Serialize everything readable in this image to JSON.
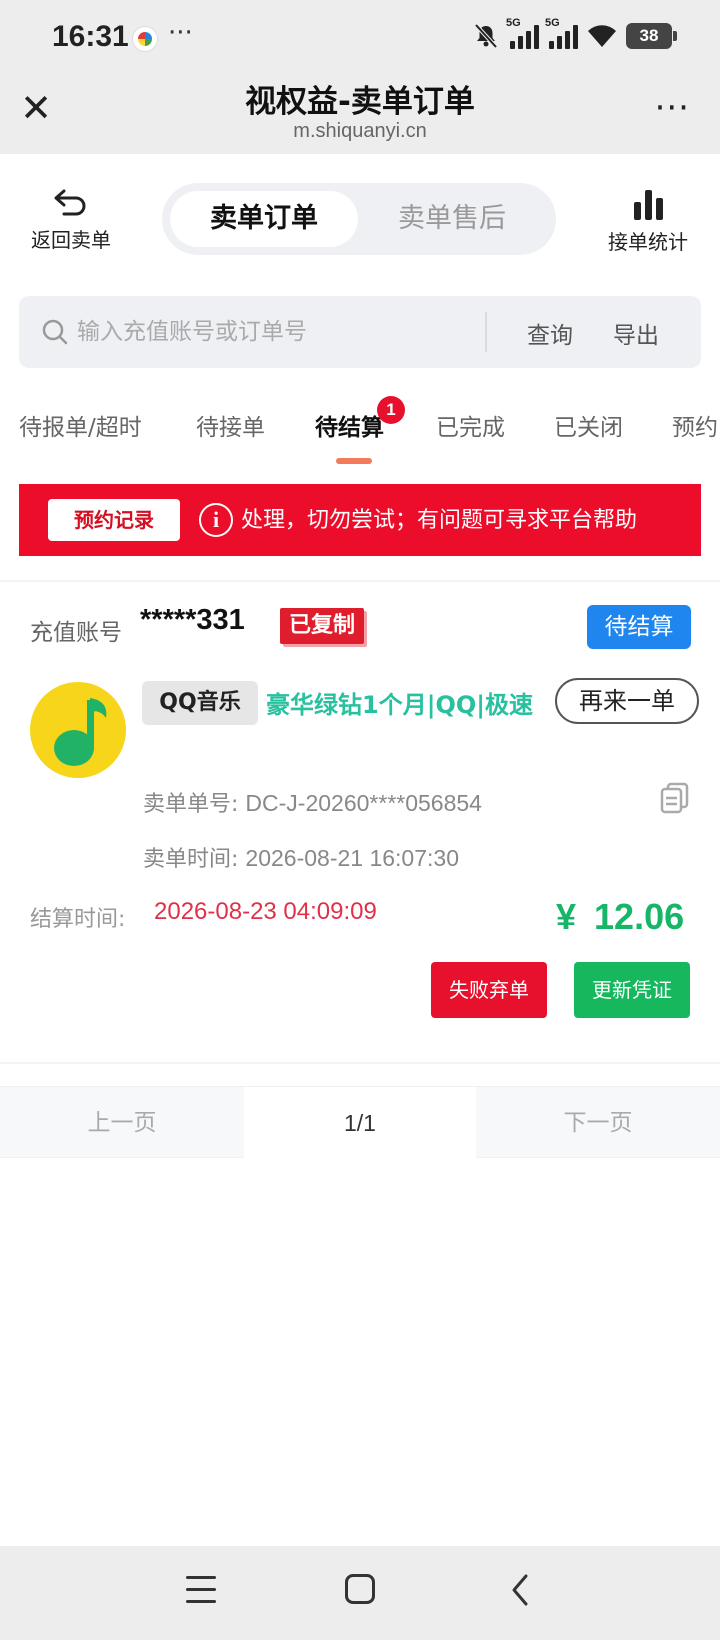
{
  "status_bar": {
    "time": "16:31",
    "dots": "···",
    "net1": "5G",
    "net2": "5G",
    "battery": "38"
  },
  "title_bar": {
    "title": "视权益-卖单订单",
    "url": "m.shiquanyi.cn",
    "more": "···"
  },
  "header": {
    "back_label": "返回卖单",
    "seg_active": "卖单订单",
    "seg_inactive": "卖单售后",
    "stats_label": "接单统计"
  },
  "search": {
    "placeholder": "输入充值账号或订单号",
    "query_label": "查询",
    "export_label": "导出"
  },
  "tabs": {
    "items": [
      {
        "label": "待报单/超时"
      },
      {
        "label": "待接单"
      },
      {
        "label": "待结算"
      },
      {
        "label": "已完成"
      },
      {
        "label": "已关闭"
      },
      {
        "label": "预约"
      }
    ],
    "badge": "1"
  },
  "notice": {
    "button_label": "预约记录",
    "icon": "i",
    "text": "处理，切勿尝试；有问题可寻求平台帮助"
  },
  "order": {
    "account_label": "充值账号",
    "account_value": "*****331",
    "copied_label": "已复制",
    "status": "待结算",
    "platform": "QQ音乐",
    "product": "豪华绿钻1个月|QQ|极速",
    "reorder_label": "再来一单",
    "order_no_label": "卖单单号:",
    "order_no": "DC-J-20260****056854",
    "order_time_label": "卖单时间:",
    "order_time": "2026-08-21 16:07:30",
    "settle_label": "结算时间:",
    "settle_time": "2026-08-23 04:09:09",
    "currency": "¥",
    "price": "12.06",
    "fail_label": "失败弃单",
    "update_label": "更新凭证"
  },
  "pager": {
    "prev": "上一页",
    "page": "1/1",
    "next": "下一页"
  },
  "colors": {
    "accent_red": "#e8112d",
    "status_blue": "#1f86ef",
    "price_green": "#17b568",
    "product_teal": "#27c1a0"
  }
}
